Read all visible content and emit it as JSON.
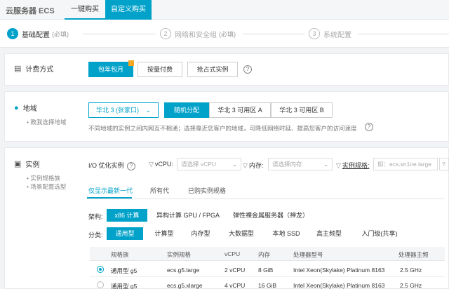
{
  "header": {
    "product_title": "云服务器 ECS",
    "tabs": [
      "一键购买",
      "自定义购买"
    ]
  },
  "steps": [
    {
      "num": "1",
      "label": "基础配置",
      "hint": "(必填)"
    },
    {
      "num": "2",
      "label": "网络和安全组",
      "hint": "(必填)"
    },
    {
      "num": "3",
      "label": "系统配置",
      "hint": ""
    }
  ],
  "billing": {
    "label": "计费方式",
    "options": [
      "包年包月",
      "按量付费",
      "抢占式实例"
    ],
    "selected": "包年包月",
    "help_icon": "?"
  },
  "region": {
    "label": "地域",
    "sub_link": "教我选择地域",
    "selected_region": "华北 3 (张家口)",
    "zones": [
      "随机分配",
      "华北 3 可用区 A",
      "华北 3 可用区 B"
    ],
    "selected_zone": "随机分配",
    "note": "不同地域的实例之间内网互不相通；选择靠近您客户的地域，可降低网络时延、提高您客户的访问速度",
    "help_icon": "?"
  },
  "instance": {
    "label": "实例",
    "sub_links": [
      "实例规格族",
      "场景配置选型"
    ],
    "filters": {
      "io_label": "I/O 优化实例",
      "vcpu_label": "vCPU:",
      "vcpu_placeholder": "请选择 vCPU",
      "mem_label": "内存:",
      "mem_placeholder": "请选择内存",
      "spec_label": "实例规格:",
      "spec_placeholder": "如：ecs.sn1ne.large"
    },
    "gen_tabs": [
      "仅显示最新一代",
      "所有代",
      "已购实例规格"
    ],
    "arch_label": "架构:",
    "arch_options": [
      "x86 计算",
      "异构计算 GPU / FPGA",
      "弹性裸金属服务器（神龙）"
    ],
    "cat_label": "分类:",
    "cat_options": [
      "通用型",
      "计算型",
      "内存型",
      "大数据型",
      "本地 SSD",
      "高主频型",
      "入门级(共享)"
    ],
    "table": {
      "headers": [
        "规格族",
        "实例规格",
        "vCPU",
        "内存",
        "处理器型号",
        "处理器主频"
      ],
      "rows": [
        {
          "family": "通用型 g5",
          "spec": "ecs.g5.large",
          "vcpu": "2 vCPU",
          "mem": "8 GiB",
          "cpu": "Intel Xeon(Skylake) Platinum 8163",
          "freq": "2.5 GHz",
          "checked": true
        },
        {
          "family": "通用型 g5",
          "spec": "ecs.g5.xlarge",
          "vcpu": "4 vCPU",
          "mem": "16 GiB",
          "cpu": "Intel Xeon(Skylake) Platinum 8163",
          "freq": "2.5 GHz",
          "checked": false
        }
      ]
    }
  },
  "colors": {
    "accent": "#00a2ca",
    "badge": "#f5a623"
  }
}
